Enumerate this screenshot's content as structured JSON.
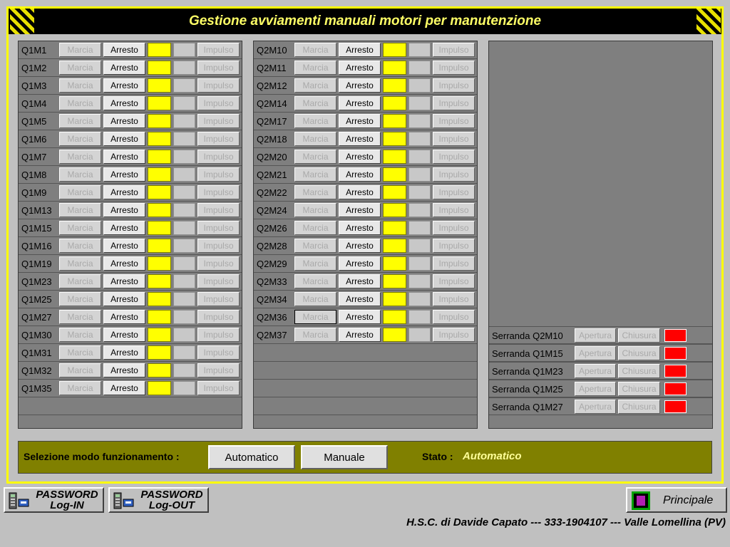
{
  "title": "Gestione avviamenti manuali motori per manutenzione",
  "labels": {
    "marcia": "Marcia",
    "arresto": "Arresto",
    "impulso": "Impulso",
    "apertura": "Apertura",
    "chiusura": "Chiusura"
  },
  "column1": [
    "Q1M1",
    "Q1M2",
    "Q1M3",
    "Q1M4",
    "Q1M5",
    "Q1M6",
    "Q1M7",
    "Q1M8",
    "Q1M9",
    "Q1M13",
    "Q1M15",
    "Q1M16",
    "Q1M19",
    "Q1M23",
    "Q1M25",
    "Q1M27",
    "Q1M30",
    "Q1M31",
    "Q1M32",
    "Q1M35"
  ],
  "column2": [
    "Q2M10",
    "Q2M11",
    "Q2M12",
    "Q2M14",
    "Q2M17",
    "Q2M18",
    "Q2M20",
    "Q2M21",
    "Q2M22",
    "Q2M24",
    "Q2M26",
    "Q2M28",
    "Q2M29",
    "Q2M33",
    "Q2M34",
    "Q2M36",
    "Q2M37"
  ],
  "serrande": [
    "Serranda Q2M10",
    "Serranda Q1M15",
    "Serranda Q1M23",
    "Serranda Q1M25",
    "Serranda Q1M27"
  ],
  "mode": {
    "label": "Selezione modo funzionamento :",
    "automatic": "Automatico",
    "manual": "Manuale",
    "stato_label": "Stato :",
    "stato_value": "Automatico"
  },
  "login": {
    "line1": "PASSWORD",
    "line2": "Log-IN"
  },
  "logout": {
    "line1": "PASSWORD",
    "line2": "Log-OUT"
  },
  "principale": "Principale",
  "footer": "H.S.C. di Davide Capato --- 333-1904107 --- Valle Lomellina (PV)",
  "colors": {
    "yellow": "#ffff00",
    "black": "#000000",
    "olive": "#808000",
    "panel": "#7f7f7f",
    "lamp_on": "#ffff00",
    "alarm": "#ff0000"
  },
  "icons": [
    "hazard-stripes-icon",
    "password-terminal-icon",
    "principale-screen-icon"
  ]
}
